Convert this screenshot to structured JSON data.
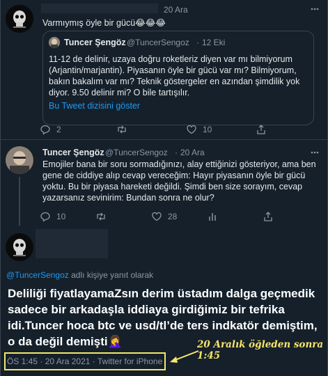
{
  "tweet1": {
    "date": "20 Ara",
    "text": "Varmıymış öyle bir gücü😂😂😂",
    "quote": {
      "name": "Tuncer Şengöz",
      "handle": "@TuncerSengoz",
      "sep": "·",
      "date": "12 Eki",
      "text": "11-12 de delinir, uzaya doğru roketleriz diyen var mı bilmiyorum (Arjantin/marjantin). Piyasanın öyle bir gücü var mı? Bilmiyorum, bakın bakalım var mı? Teknik göstergeler en azından şimdilik yok diyor. 9.50 delinir mi? O bile tartışılır.",
      "link": "Bu Tweet dizisini göster"
    },
    "replies": "2",
    "retweets": "",
    "likes": "10"
  },
  "tweet2": {
    "name": "Tuncer Şengöz",
    "handle": "@TuncerSengoz",
    "sep": "·",
    "date": "20 Ara",
    "text": "Emojiler bana bir soru sormadığınızı, alay ettiğinizi gösteriyor, ama ben gene de ciddiye alıp cevap vereceğim: Hayır piyasanın öyle bir gücü yoktu. Bu bir piyasa hareketi değildi. Şimdi ben size sorayım, cevap yazarsanız sevinirim: Bundan sonra ne olur?",
    "replies": "10",
    "retweets": "",
    "likes": "28"
  },
  "tweet3": {
    "reply_to_handle": "@TuncerSengoz",
    "reply_to_suffix": " adlı kişiye yanıt olarak",
    "text": "Deliliği fiyatlayamaZsın derim üstadım dalga geçmedik sadece bir arkadaşla iddiaya girdiğimiz bir tefrika idi.Tuncer hoca btc ve usd/tl’de ters indkatör demiştim, o da değil demişti🤦‍♀️",
    "meta": "ÖS 1:45 · 20 Ara 2021 · Twitter for iPhone",
    "annotation": "20 Aralık öğleden sonra 1:45"
  },
  "icons": [
    "reply-icon",
    "retweet-icon",
    "like-icon",
    "analytics-icon",
    "share-icon",
    "arrow-icon"
  ],
  "colors": {
    "background": "#15202b",
    "link": "#1d9bf0",
    "highlight": "#f7e56a",
    "muted": "#8b98a5"
  }
}
